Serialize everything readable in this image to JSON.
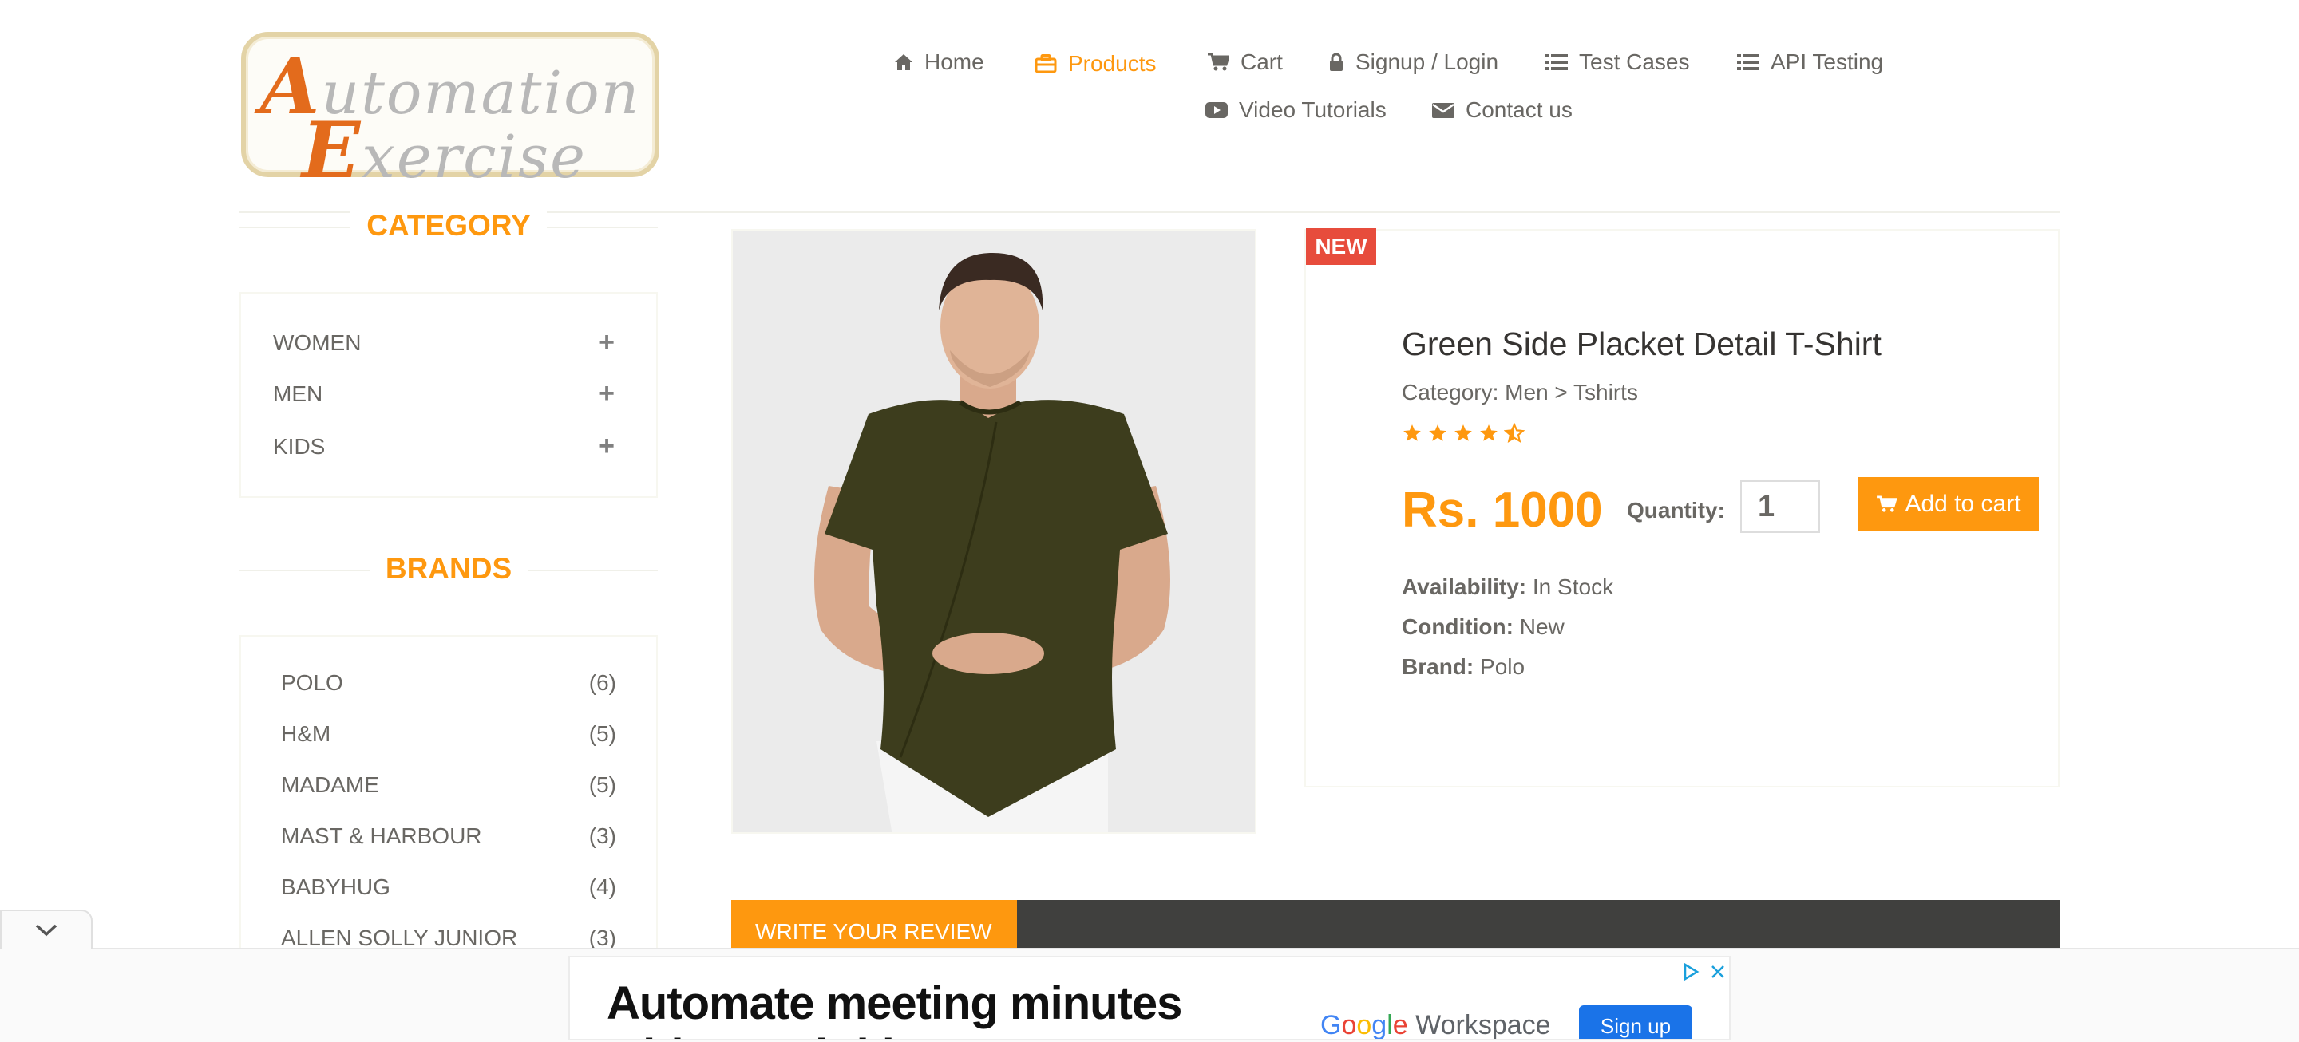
{
  "logo": {
    "line1": "utomation",
    "line1_cap": "A",
    "line2": "xercise",
    "line2_cap": "E"
  },
  "nav": [
    {
      "label": "Home",
      "icon": "home-icon"
    },
    {
      "label": "Products",
      "icon": "briefcase-icon",
      "active": true
    },
    {
      "label": "Cart",
      "icon": "cart-icon"
    },
    {
      "label": "Signup / Login",
      "icon": "lock-icon"
    },
    {
      "label": "Test Cases",
      "icon": "list-icon"
    },
    {
      "label": "API Testing",
      "icon": "list-icon"
    },
    {
      "label": "Video Tutorials",
      "icon": "youtube-icon"
    },
    {
      "label": "Contact us",
      "icon": "envelope-icon"
    }
  ],
  "sidebar": {
    "category_title": "CATEGORY",
    "categories": [
      {
        "label": "WOMEN",
        "expand": "+"
      },
      {
        "label": "MEN",
        "expand": "+"
      },
      {
        "label": "KIDS",
        "expand": "+"
      }
    ],
    "brands_title": "BRANDS",
    "brands": [
      {
        "label": "POLO",
        "count": "(6)"
      },
      {
        "label": "H&M",
        "count": "(5)"
      },
      {
        "label": "MADAME",
        "count": "(5)"
      },
      {
        "label": "MAST & HARBOUR",
        "count": "(3)"
      },
      {
        "label": "BABYHUG",
        "count": "(4)"
      },
      {
        "label": "ALLEN SOLLY JUNIOR",
        "count": "(3)"
      }
    ]
  },
  "product": {
    "badge": "NEW",
    "name": "Green Side Placket Detail T-Shirt",
    "category": "Category: Men > Tshirts",
    "rating": 4.5,
    "price": "Rs. 1000",
    "quantity_label": "Quantity:",
    "quantity_value": "1",
    "add_to_cart": "Add to cart",
    "availability_label": "Availability:",
    "availability_value": "In Stock",
    "condition_label": "Condition:",
    "condition_value": "New",
    "brand_label": "Brand:",
    "brand_value": "Polo"
  },
  "review": {
    "tab_label": "WRITE YOUR REVIEW"
  },
  "ad": {
    "headline": "Automate meeting minutes",
    "headline2": "with Gemini in Meet",
    "brand_word": "Workspace",
    "brand_google": [
      "G",
      "o",
      "o",
      "g",
      "l",
      "e"
    ],
    "cta": "Sign up"
  },
  "colors": {
    "accent": "#fe980f",
    "text": "#696763",
    "badge": "#e74c3c",
    "dark_bar": "#40403e"
  }
}
